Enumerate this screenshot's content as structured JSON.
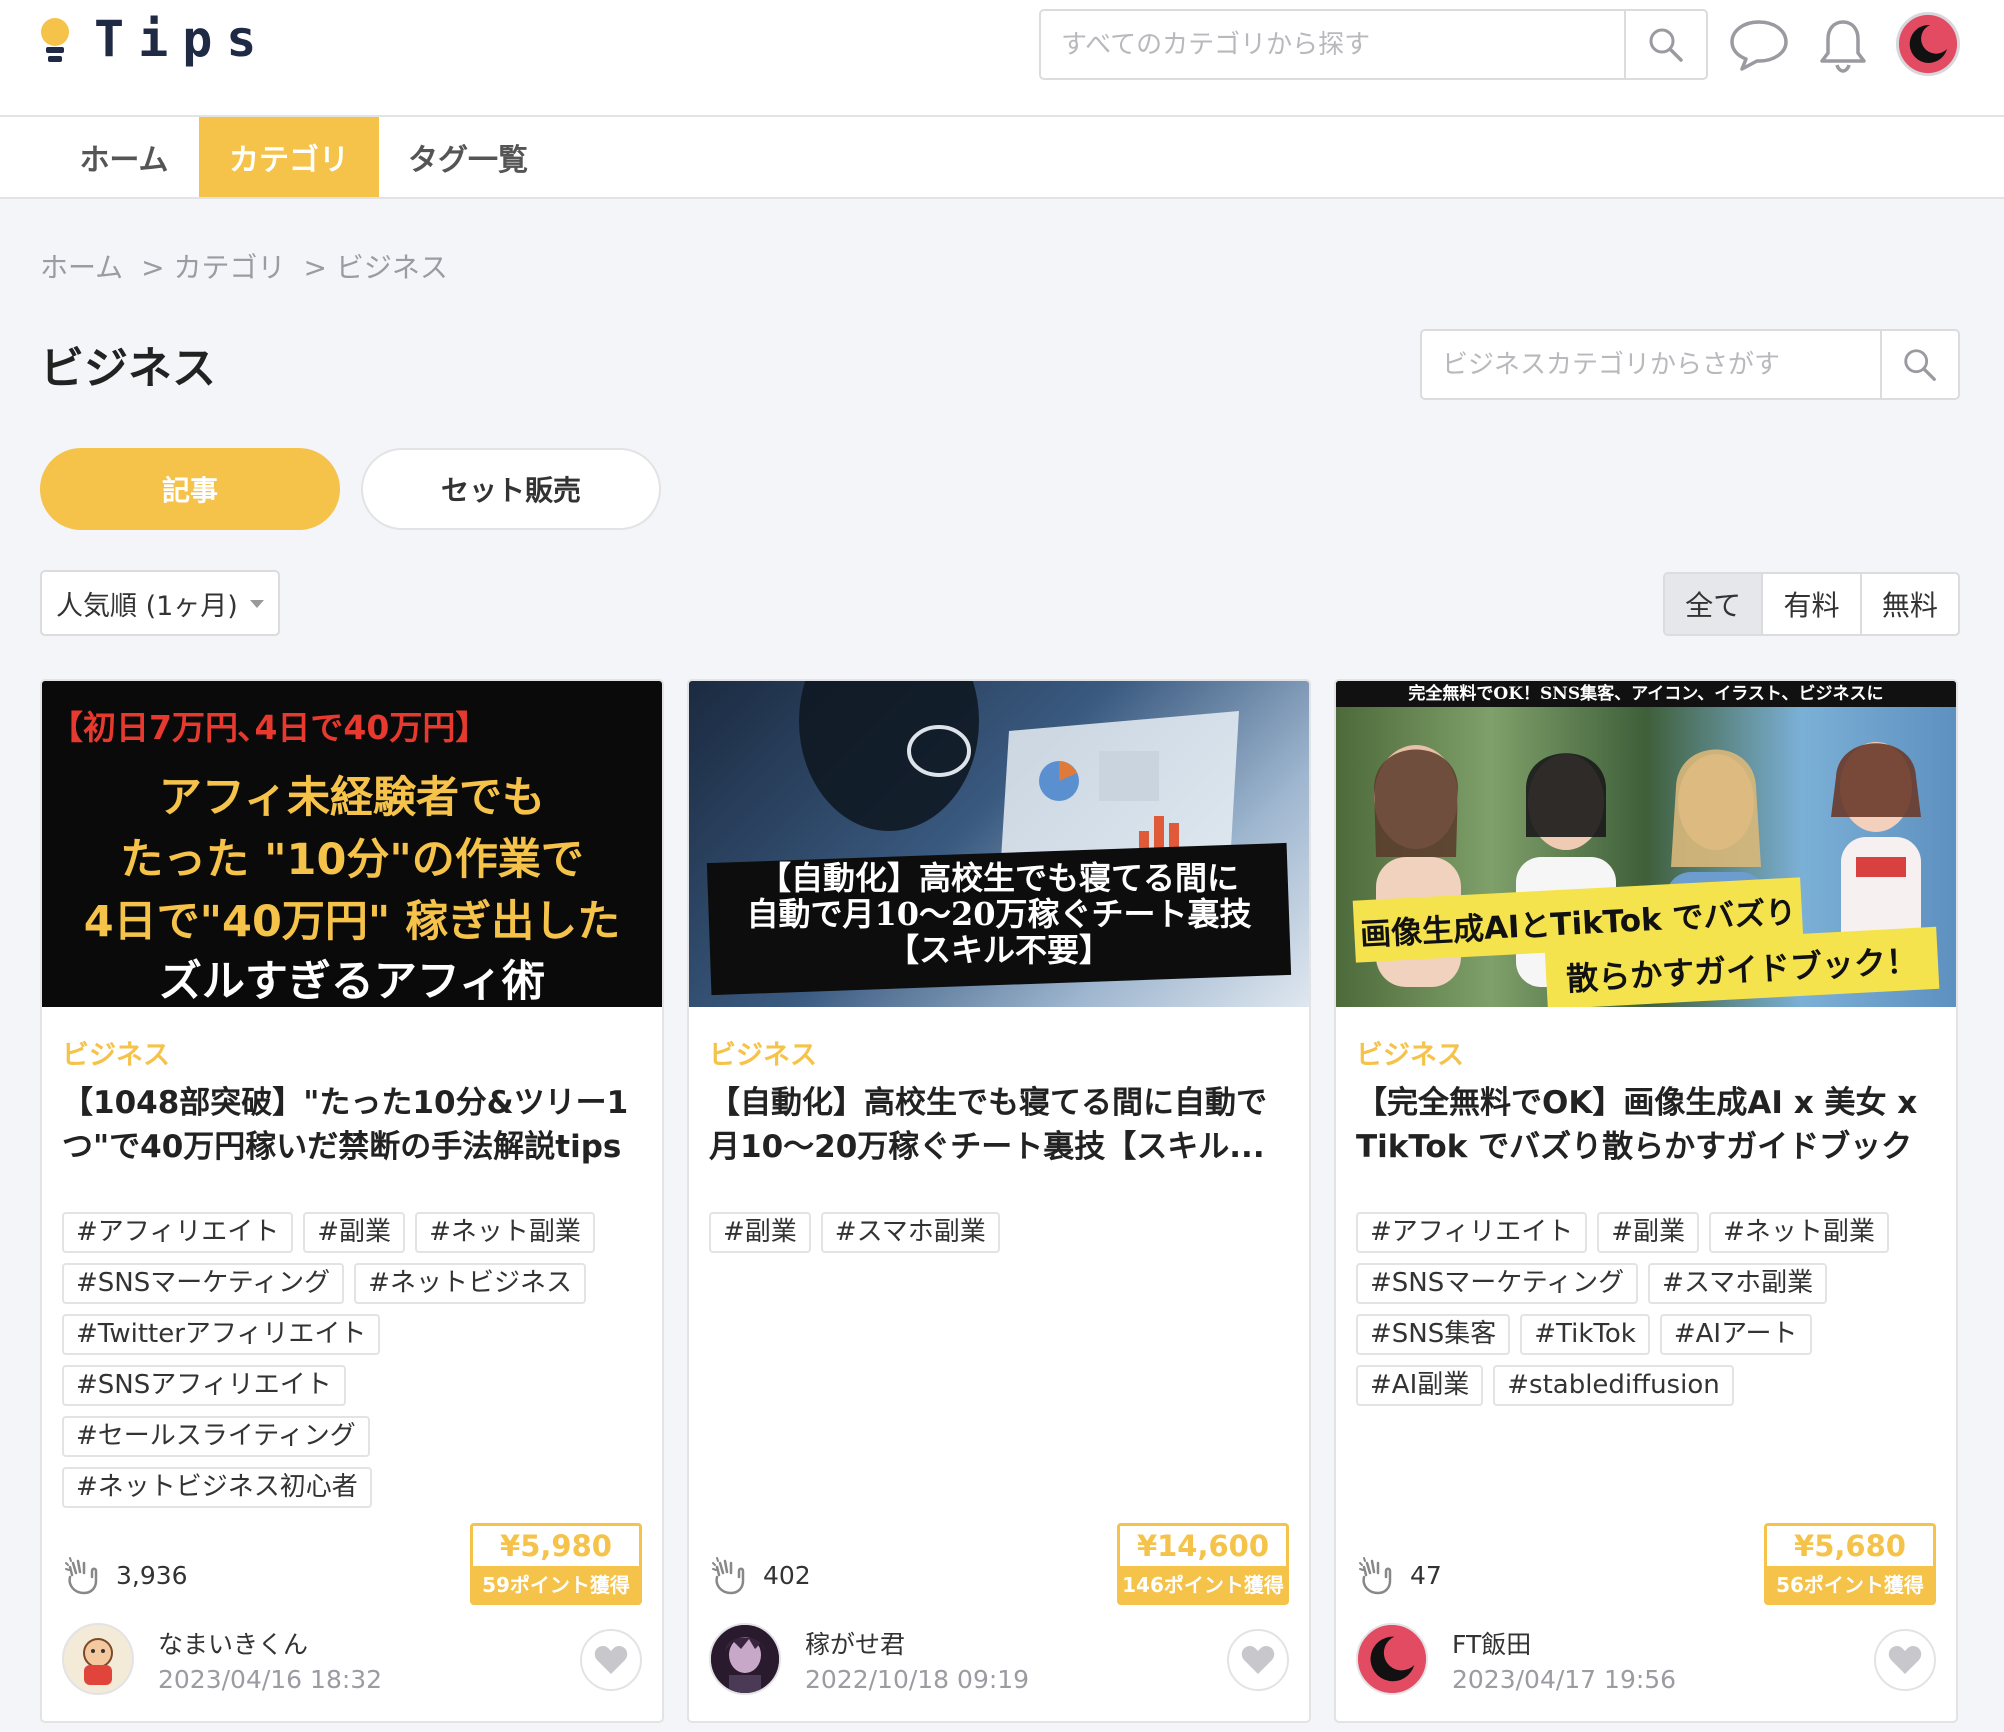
{
  "header": {
    "logo_text": "Tips",
    "search_placeholder": "すべてのカテゴリから探す",
    "accent_color": "#f5c24a",
    "icons": [
      "search-icon",
      "chat-icon",
      "bell-icon",
      "user-avatar"
    ]
  },
  "nav": {
    "tabs": [
      {
        "label": "ホーム",
        "active": false
      },
      {
        "label": "カテゴリ",
        "active": true
      },
      {
        "label": "タグ一覧",
        "active": false
      }
    ]
  },
  "breadcrumb": {
    "items": [
      "ホーム",
      "> カテゴリ",
      "> ビジネス"
    ]
  },
  "page": {
    "title": "ビジネス",
    "category_search_placeholder": "ビジネスカテゴリからさがす"
  },
  "content_toggle": {
    "articles": "記事",
    "bundles": "セット販売",
    "selected": "記事"
  },
  "sort": {
    "selected": "人気順 (1ヶ月)"
  },
  "price_filter": {
    "options": [
      "全て",
      "有料",
      "無料"
    ],
    "selected": "全て"
  },
  "cards": [
    {
      "thumb": {
        "lines": [
          "【初日7万円､4日で40万円】",
          "アフィ未経験者でも",
          "たった \"10分\"の作業で",
          "4日で\"40万円\" 稼ぎ出した",
          "ズルすぎるアフィ術"
        ]
      },
      "category": "ビジネス",
      "title": "【1048部突破】\"たった10分&ツリー1つ\"で40万円稼いだ禁断の手法解説tips",
      "tags": [
        "#アフィリエイト",
        "#副業",
        "#ネット副業",
        "#SNSマーケティング",
        "#ネットビジネス",
        "#Twitterアフィリエイト",
        "#SNSアフィリエイト",
        "#セールスライティング",
        "#ネットビジネス初心者"
      ],
      "claps": "3,936",
      "price": "¥5,980",
      "points": "59ポイント獲得",
      "author": "なまいきくん",
      "date": "2023/04/16 18:32"
    },
    {
      "thumb": {
        "lines": [
          "【自動化】高校生でも寝てる間に",
          "自動で月10〜20万稼ぐチート裏技",
          "【スキル不要】"
        ]
      },
      "category": "ビジネス",
      "title": "【自動化】高校生でも寝てる間に自動で月10〜20万稼ぐチート裏技【スキル...",
      "tags": [
        "#副業",
        "#スマホ副業"
      ],
      "claps": "402",
      "price": "¥14,600",
      "points": "146ポイント獲得",
      "author": "稼がせ君",
      "date": "2022/10/18 09:19"
    },
    {
      "thumb": {
        "lines": [
          "完全無料でOK！SNS集客、アイコン、イラスト、ビジネスに",
          "画像生成AIとTikTok でバズり",
          "散らかすガイドブック！"
        ]
      },
      "category": "ビジネス",
      "title": "【完全無料でOK】画像生成AI x 美女 x TikTok でバズり散らかすガイドブック",
      "tags": [
        "#アフィリエイト",
        "#副業",
        "#ネット副業",
        "#SNSマーケティング",
        "#スマホ副業",
        "#SNS集客",
        "#TikTok",
        "#AIアート",
        "#AI副業",
        "#stablediffusion"
      ],
      "claps": "47",
      "price": "¥5,680",
      "points": "56ポイント獲得",
      "author": "FT飯田",
      "date": "2023/04/17 19:56"
    }
  ]
}
